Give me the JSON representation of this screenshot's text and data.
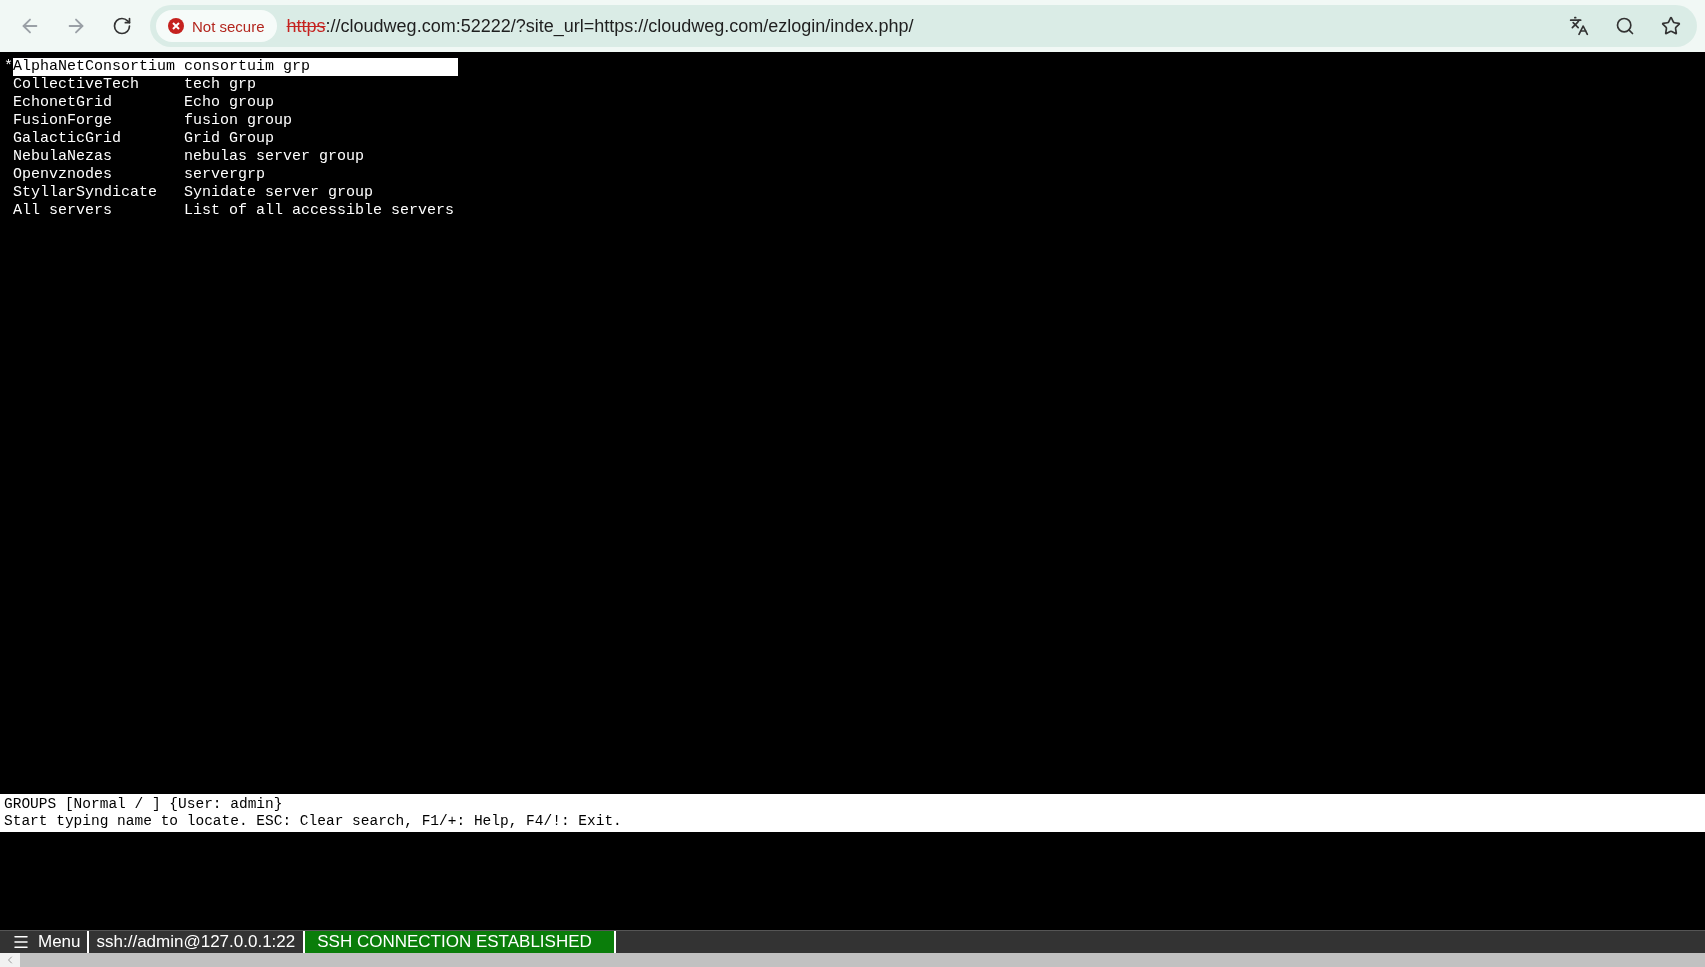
{
  "browser": {
    "security_label": "Not secure",
    "url_scheme": "https",
    "url_rest": "://cloudweg.com:52222/?site_url=https://cloudweg.com/ezlogin/index.php/"
  },
  "terminal": {
    "marker": "*",
    "rows": [
      {
        "name": "AlphaNetConsortium",
        "description": "consortuim grp",
        "selected": true
      },
      {
        "name": "CollectiveTech",
        "description": "tech grp",
        "selected": false
      },
      {
        "name": "EchonetGrid",
        "description": "Echo group",
        "selected": false
      },
      {
        "name": "FusionForge",
        "description": "fusion group",
        "selected": false
      },
      {
        "name": "GalacticGrid",
        "description": "Grid Group",
        "selected": false
      },
      {
        "name": "NebulaNezas",
        "description": "nebulas server group",
        "selected": false
      },
      {
        "name": "Openvznodes",
        "description": "servergrp",
        "selected": false
      },
      {
        "name": "StyllarSyndicate",
        "description": "Synidate server group",
        "selected": false
      },
      {
        "name": "All servers",
        "description": "List of all accessible servers",
        "selected": false
      }
    ],
    "status_lines": [
      "GROUPS [Normal / ] {User: admin}",
      "Start typing name to locate. ESC: Clear search, F1/+: Help, F4/!: Exit."
    ]
  },
  "bottom_bar": {
    "menu": "Menu",
    "address": "ssh://admin@127.0.0.1:22",
    "connection": "SSH CONNECTION ESTABLISHED"
  }
}
